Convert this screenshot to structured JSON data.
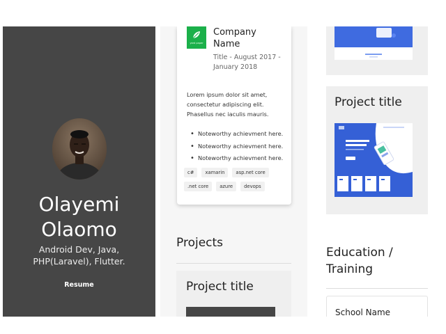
{
  "profile": {
    "first_name": "Olayemi",
    "last_name": "Olaomo",
    "subtitle_line1": "Android Dev, Java,",
    "subtitle_line2": "PHP(Laravel), Flutter.",
    "resume_label": "Resume"
  },
  "experience": {
    "logo_text": "yard paper",
    "company_name": "Company Name",
    "dates": "Title - August 2017 - January 2018",
    "description": "Lorem ipsum dolor sit amet, consectetur adipiscing elit. Phasellus nec iaculis mauris.",
    "achievements": [
      "Noteworthy achievment here.",
      "Noteworthy achievment here.",
      "Noteworthy achievment here."
    ],
    "tags": [
      "c#",
      "xamarin",
      "asp.net core",
      ".net core",
      "azure",
      "devops"
    ]
  },
  "projects": {
    "heading": "Projects",
    "card_title": "Project title"
  },
  "right": {
    "project_title": "Project title",
    "education_heading_line1": "Education /",
    "education_heading_line2": "Training",
    "school_name": "School Name"
  },
  "colors": {
    "sidebar_bg": "#464646",
    "brand_green": "#1bb04a",
    "preview_blue": "#3560d6"
  }
}
